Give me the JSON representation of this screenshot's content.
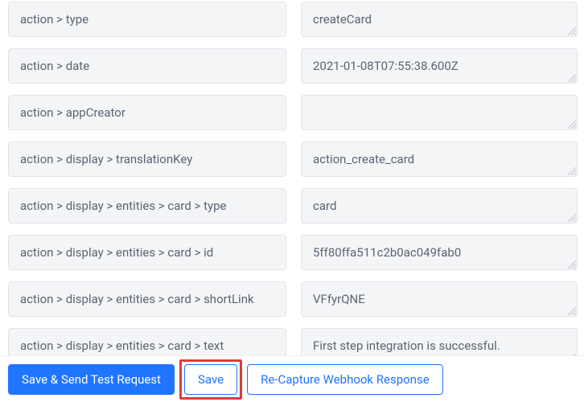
{
  "rows": [
    {
      "key": "action > type",
      "value": "createCard"
    },
    {
      "key": "action > date",
      "value": "2021-01-08T07:55:38.600Z"
    },
    {
      "key": "action > appCreator",
      "value": ""
    },
    {
      "key": "action > display > translationKey",
      "value": "action_create_card"
    },
    {
      "key": "action > display > entities > card > type",
      "value": "card"
    },
    {
      "key": "action > display > entities > card > id",
      "value": "5ff80ffa511c2b0ac049fab0"
    },
    {
      "key": "action > display > entities > card > shortLink",
      "value": "VFfyrQNE"
    },
    {
      "key": "action > display > entities > card > text",
      "value": "First step integration is successful."
    }
  ],
  "footer": {
    "save_send_label": "Save & Send Test Request",
    "save_label": "Save",
    "recapture_label": "Re-Capture Webhook Response"
  },
  "colors": {
    "primary": "#1f75fe",
    "highlight": "#e53935",
    "field_bg": "#f4f5f7",
    "field_border": "#e2e4e9"
  }
}
